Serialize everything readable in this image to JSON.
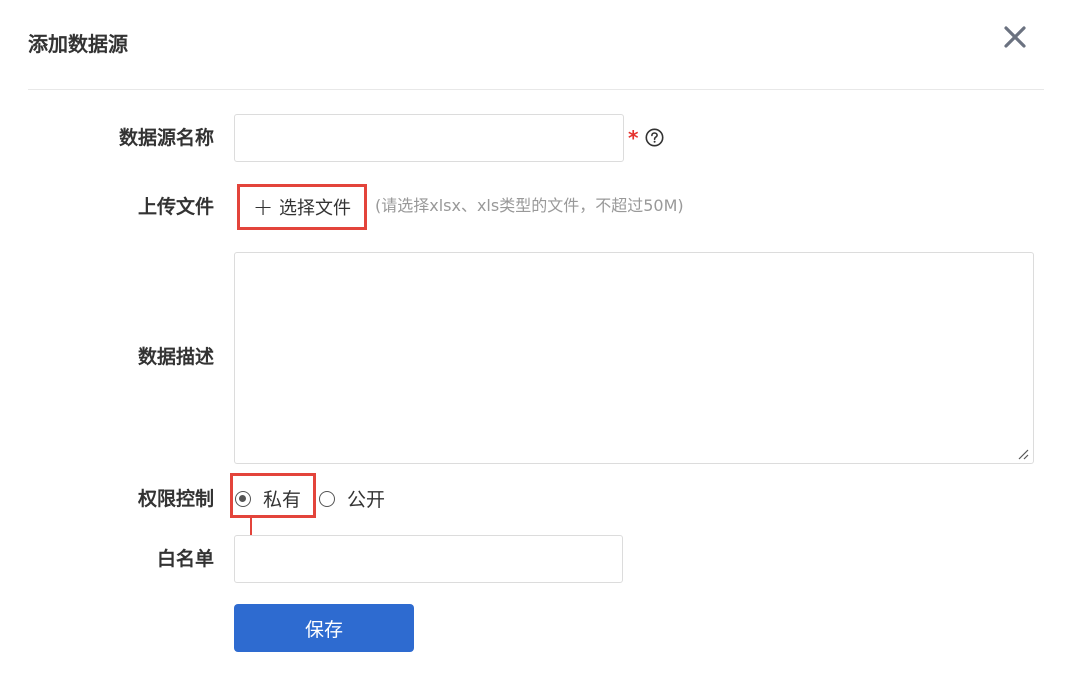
{
  "dialog": {
    "title": "添加数据源",
    "close_icon": "close-icon"
  },
  "form": {
    "datasource_name": {
      "label": "数据源名称",
      "value": "",
      "required_mark": "*",
      "help_icon": "question-circle-icon"
    },
    "upload": {
      "label": "上传文件",
      "button_icon": "plus-icon",
      "button_label": "选择文件",
      "hint": "(请选择xlsx、xls类型的文件，不超过50M)"
    },
    "description": {
      "label": "数据描述",
      "value": ""
    },
    "permission": {
      "label": "权限控制",
      "options": [
        {
          "label": "私有",
          "checked": true
        },
        {
          "label": "公开",
          "checked": false
        }
      ]
    },
    "whitelist": {
      "label": "白名单",
      "value": ""
    },
    "save_label": "保存"
  },
  "colors": {
    "accent": "#2e6bd0",
    "annotation_red": "#e3443b",
    "required_red": "#e5322d"
  }
}
